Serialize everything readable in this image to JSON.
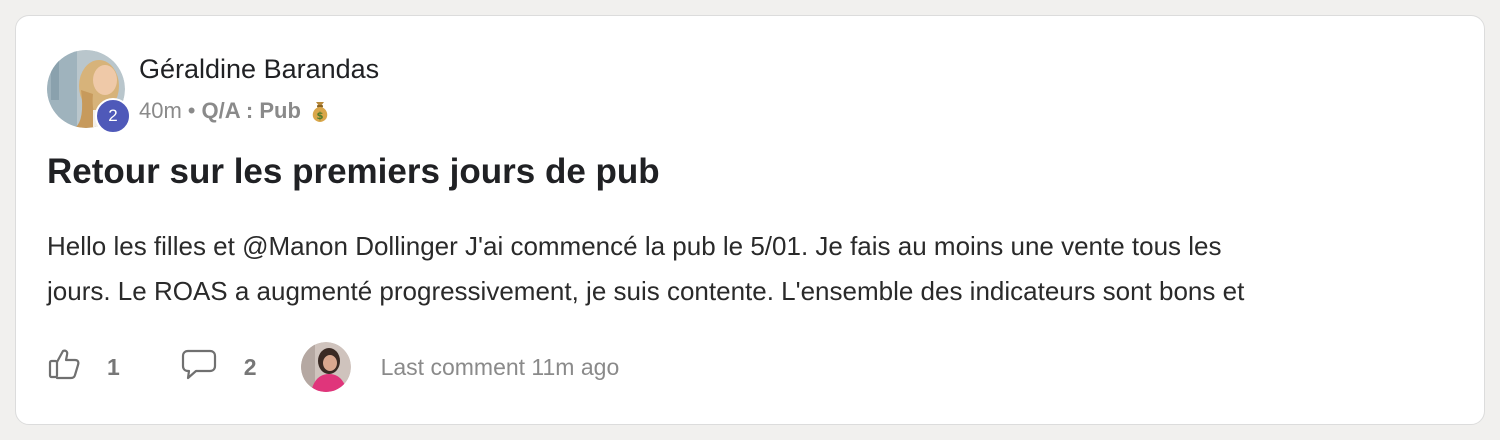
{
  "post": {
    "author": {
      "name": "Géraldine Barandas",
      "level": "2",
      "avatar": "author-avatar-photo"
    },
    "meta": {
      "time": "40m",
      "separator": "•",
      "category": "Q/A : Pub",
      "category_icon": "money-bag-icon"
    },
    "title": "Retour sur les premiers jours de pub",
    "body_lines": [
      "Hello les filles et @Manon Dollinger J'ai commencé la pub le 5/01. Je fais au moins une vente tous les",
      "jours. Le ROAS a augmenté progressivement, je suis contente. L'ensemble des indicateurs sont bons et"
    ],
    "footer": {
      "likes_icon": "thumbs-up-icon",
      "likes": "1",
      "comments_icon": "comment-icon",
      "comments": "2",
      "last_commenter_avatar": "commenter-avatar-photo",
      "last_comment": "Last comment 11m ago"
    }
  },
  "colors": {
    "page_bg": "#f1f0ee",
    "card_bg": "#ffffff",
    "level_badge": "#4f59b9",
    "text_primary": "#202124",
    "text_muted": "#8a8a8a"
  }
}
